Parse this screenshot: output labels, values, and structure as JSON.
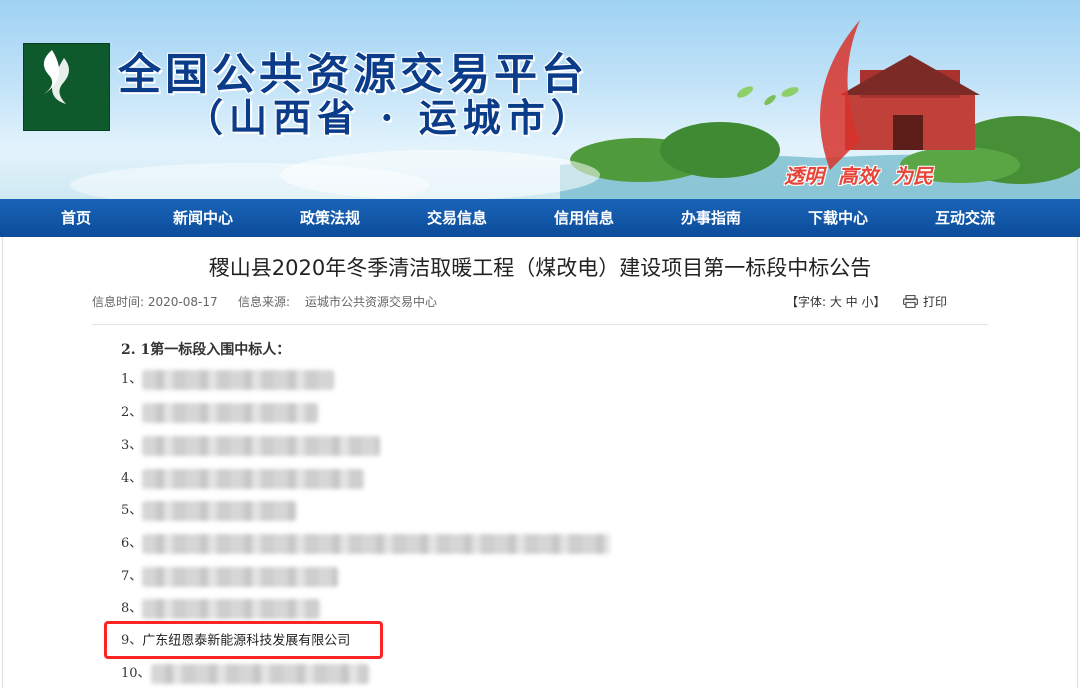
{
  "header": {
    "site_title": "全国公共资源交易平台",
    "site_subtitle": "（山西省 · 运城市）",
    "slogans": [
      "透明",
      "高效",
      "为民"
    ]
  },
  "nav": {
    "items": [
      "首页",
      "新闻中心",
      "政策法规",
      "交易信息",
      "信用信息",
      "办事指南",
      "下载中心",
      "互动交流"
    ]
  },
  "article": {
    "title": "稷山县2020年冬季清洁取暖工程（煤改电）建设项目第一标段中标公告",
    "info_time": "信息时间: 2020-08-17",
    "info_source_label": "信息来源:",
    "info_source": "运城市公共资源交易中心",
    "font_size_control": "【字体: 大 中 小】",
    "print_label": "打印",
    "section_heading": "2. 1第一标段入围中标人：",
    "candidates": [
      {
        "num": "1、",
        "name": ""
      },
      {
        "num": "2、",
        "name": ""
      },
      {
        "num": "3、",
        "name": ""
      },
      {
        "num": "4、",
        "name": ""
      },
      {
        "num": "5、",
        "name": ""
      },
      {
        "num": "6、",
        "name": ""
      },
      {
        "num": "7、",
        "name": ""
      },
      {
        "num": "8、",
        "name": ""
      },
      {
        "num": "9、",
        "name": "广东纽恩泰新能源科技发展有限公司"
      },
      {
        "num": "10、",
        "name": ""
      }
    ]
  },
  "colors": {
    "nav_bg": "#0c4c9a",
    "title_blue": "#0b3c8a",
    "highlight": "#ff2424",
    "slogan_red": "#e8453a"
  }
}
